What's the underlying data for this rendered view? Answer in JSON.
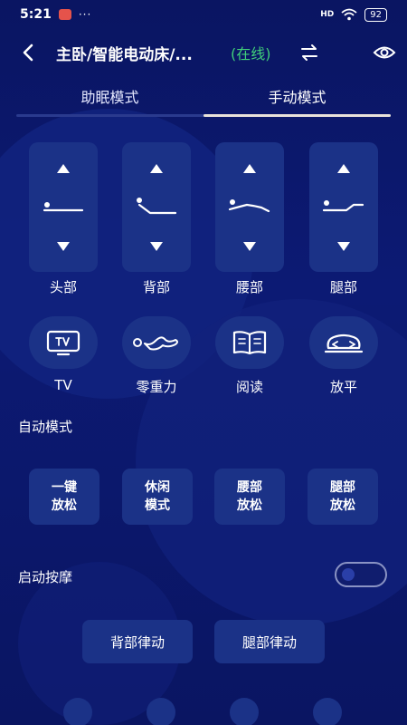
{
  "status_bar": {
    "time": "5:21",
    "more": "···",
    "signal": "HD",
    "battery": "92"
  },
  "nav": {
    "title": "主卧/智能电动床/...",
    "status": "(在线)"
  },
  "tabs": [
    {
      "label": "助眠模式",
      "active": false
    },
    {
      "label": "手动模式",
      "active": true
    }
  ],
  "controls": [
    {
      "label": "头部",
      "icon": "head-pose-icon"
    },
    {
      "label": "背部",
      "icon": "back-pose-icon"
    },
    {
      "label": "腰部",
      "icon": "waist-pose-icon"
    },
    {
      "label": "腿部",
      "icon": "leg-pose-icon"
    }
  ],
  "modes": [
    {
      "label": "TV",
      "icon": "tv-icon"
    },
    {
      "label": "零重力",
      "icon": "zero-gravity-icon"
    },
    {
      "label": "阅读",
      "icon": "book-icon"
    },
    {
      "label": "放平",
      "icon": "flat-icon"
    }
  ],
  "auto_mode": {
    "title": "自动模式",
    "buttons": [
      {
        "label": "一键放松"
      },
      {
        "label": "休闲模式"
      },
      {
        "label": "腰部放松"
      },
      {
        "label": "腿部放松"
      }
    ]
  },
  "massage": {
    "title": "启动按摩",
    "enabled": false,
    "buttons": [
      {
        "label": "背部律动"
      },
      {
        "label": "腿部律动"
      }
    ]
  },
  "colors": {
    "background": "#0b1566",
    "card": "#1b3287",
    "online": "#41d07a",
    "tab_indicator": "#e9e3da"
  }
}
